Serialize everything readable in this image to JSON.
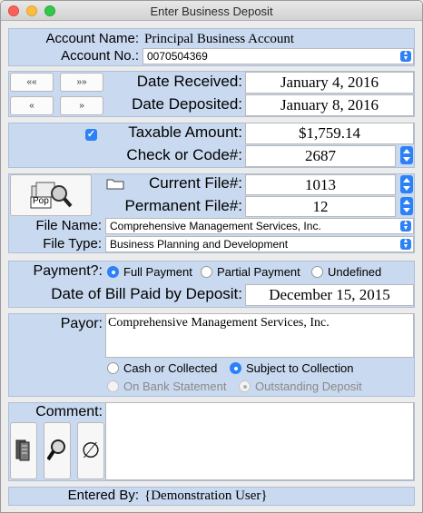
{
  "window": {
    "title": "Enter Business Deposit"
  },
  "account": {
    "name_label": "Account Name:",
    "name_value": "Principal Business Account",
    "number_label": "Account No.:",
    "number_value": "0070504369"
  },
  "dates": {
    "nav_first": "««",
    "nav_last": "»»",
    "nav_prev": "«",
    "nav_next": "»",
    "received_label": "Date Received:",
    "received_value": "January 4, 2016",
    "deposited_label": "Date Deposited:",
    "deposited_value": "January 8, 2016"
  },
  "amount": {
    "taxable_checked": true,
    "taxable_label": "Taxable Amount:",
    "taxable_value": "$1,759.14",
    "check_label": "Check or Code#:",
    "check_value": "2687"
  },
  "files": {
    "pop_label": "Pop",
    "current_label": "Current File#:",
    "current_value": "1013",
    "permanent_label": "Permanent File#:",
    "permanent_value": "12",
    "name_label": "File Name:",
    "name_value": "Comprehensive Management Services, Inc.",
    "type_label": "File Type:",
    "type_value": "Business Planning and Development"
  },
  "payment": {
    "label": "Payment?:",
    "options": [
      "Full Payment",
      "Partial Payment",
      "Undefined"
    ],
    "selected": "Full Payment",
    "bill_date_label": "Date of Bill Paid by Deposit:",
    "bill_date_value": "December 15, 2015"
  },
  "payor": {
    "label": "Payor:",
    "value": "Comprehensive Management Services, Inc.",
    "collection_options": [
      "Cash or Collected",
      "Subject to Collection"
    ],
    "collection_selected": "Subject to Collection",
    "status_options": [
      "On Bank Statement",
      "Outstanding Deposit"
    ],
    "status_selected": "Outstanding Deposit"
  },
  "comment": {
    "label": "Comment:",
    "value": "",
    "tools": [
      "copy-icon",
      "magnifier-icon",
      "clear-icon"
    ]
  },
  "footer": {
    "entered_by_label": "Entered By:",
    "entered_by_value": "{Demonstration User}"
  },
  "colors": {
    "band": "#c9d9ef",
    "accent": "#2d81f7"
  }
}
